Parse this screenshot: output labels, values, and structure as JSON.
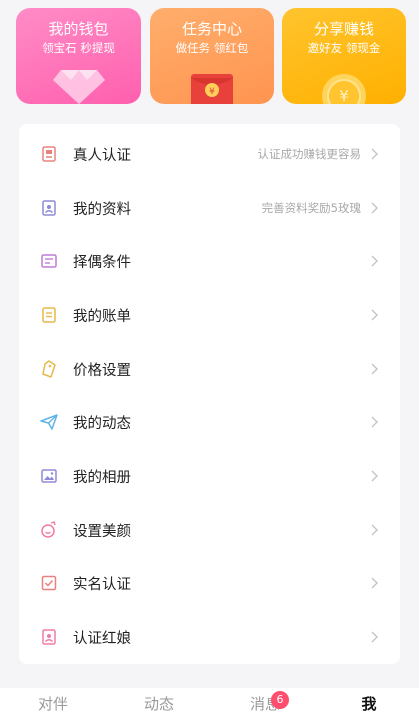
{
  "cards": [
    {
      "title": "我的钱包",
      "subtitle": "领宝石 秒提现",
      "icon": "diamond-icon",
      "color": "#ff6fb5"
    },
    {
      "title": "任务中心",
      "subtitle": "做任务 领红包",
      "icon": "red-envelope-icon",
      "color": "#ffa05e"
    },
    {
      "title": "分享赚钱",
      "subtitle": "邀好友 领现金",
      "icon": "coin-icon",
      "color": "#ffb814"
    }
  ],
  "menu": [
    {
      "label": "真人认证",
      "hint": "认证成功赚钱更容易",
      "icon": "id-card-icon"
    },
    {
      "label": "我的资料",
      "hint": "完善资料奖励5玫瑰",
      "icon": "profile-icon"
    },
    {
      "label": "择偶条件",
      "hint": "",
      "icon": "preferences-icon"
    },
    {
      "label": "我的账单",
      "hint": "",
      "icon": "bill-icon"
    },
    {
      "label": "价格设置",
      "hint": "",
      "icon": "price-tag-icon"
    },
    {
      "label": "我的动态",
      "hint": "",
      "icon": "paper-plane-icon"
    },
    {
      "label": "我的相册",
      "hint": "",
      "icon": "photo-icon"
    },
    {
      "label": "设置美颜",
      "hint": "",
      "icon": "beauty-icon"
    },
    {
      "label": "实名认证",
      "hint": "",
      "icon": "verified-icon"
    },
    {
      "label": "认证红娘",
      "hint": "",
      "icon": "matchmaker-icon"
    }
  ],
  "tabs": [
    {
      "label": "对伴",
      "active": false
    },
    {
      "label": "动态",
      "active": false
    },
    {
      "label": "消息",
      "active": false,
      "badge": "6"
    },
    {
      "label": "我",
      "active": true
    }
  ],
  "colors": {
    "accent_pink": "#ff6fb5",
    "accent_orange": "#ffa05e",
    "accent_yellow": "#ffb814",
    "badge": "#ff4d6d"
  }
}
